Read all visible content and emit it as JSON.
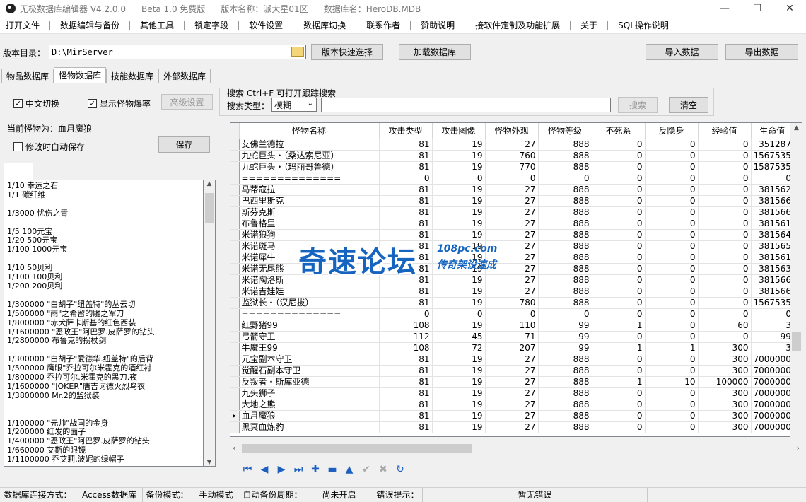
{
  "window": {
    "title_segments": [
      "无极数据库编辑器 V4.2.0.0",
      "Beta 1.0 免费版",
      "版本名称：派大星01区",
      "数据库名：HeroDB.MDB"
    ]
  },
  "menu": [
    "打开文件",
    "数据编辑与备份",
    "其他工具",
    "锁定字段",
    "软件设置",
    "数据库切换",
    "联系作者",
    "赞助说明",
    "接软件定制及功能扩展",
    "关于",
    "SQL操作说明"
  ],
  "toolbar": {
    "dir_label": "版本目录：",
    "dir_value": "D:\\MirServer",
    "quick_select": "版本快速选择",
    "load_db": "加载数据库",
    "import": "导入数据",
    "export": "导出数据"
  },
  "tabs": [
    "物品数据库",
    "怪物数据库",
    "技能数据库",
    "外部数据库"
  ],
  "options": {
    "chinese": "中文切换",
    "show_drop": "显示怪物爆率",
    "advanced": "高级设置",
    "current_monster": "当前怪物为：血月魔狼",
    "auto_save": "修改时自动保存",
    "save": "保存"
  },
  "search": {
    "title": "搜索   Ctrl+F 可打开跟踪搜索",
    "type_label": "搜索类型：",
    "type_value": "模糊",
    "search_btn": "搜索",
    "clear_btn": "清空"
  },
  "drop_list": "1/10 幸运之石\n1/1 碳纤维\n\n1/3000 忧伤之青\n\n1/5 100元宝\n1/20 500元宝\n1/100 1000元宝\n\n1/10 50贝利\n1/100 100贝利\n1/200 200贝利\n\n1/300000 \"白胡子\"纽盖特\"的丛云切\n1/500000 \"雨\"之希留的雕之军刀\n1/800000 \"赤犬萨卡斯基的红色西装\n1/1600000 \"恶政王\"阿巴罗.皮萨罗的钻头\n1/2800000 布鲁克的拐杖剑\n\n1/300000 \"白胡子\"爱德华.纽盖特\"的后背\n1/500000 鹰眼\"乔拉可尔米霍克的酒红衬\n1/800000 乔拉可尔.米霍克的黑刀.夜\n1/1600000 \"JOKER\"唐吉诃德火烈鸟衣\n1/3800000 Mr.2的监狱装\n\n\n1/100000 \"元帅\"战国的金身\n1/200000 红发的面子\n1/400000 \"恶政王\"阿巴罗.皮萨罗的钻头\n1/660000 艾斯的眼镜\n1/1100000 乔艾莉.波妮的绿帽子",
  "grid": {
    "columns": [
      "怪物名称",
      "攻击类型",
      "攻击图像",
      "怪物外观",
      "怪物等级",
      "不死系",
      "反隐身",
      "经验值",
      "生命值"
    ],
    "rows": [
      [
        "艾佛兰德拉",
        "81",
        "19",
        "27",
        "888",
        "0",
        "0",
        "0",
        "351287"
      ],
      [
        "九蛇巨头・（桑达索尼亚）",
        "81",
        "19",
        "760",
        "888",
        "0",
        "0",
        "0",
        "1567535"
      ],
      [
        "九蛇巨头・（玛丽哥鲁德）",
        "81",
        "19",
        "770",
        "888",
        "0",
        "0",
        "0",
        "1587535"
      ],
      [
        "==============",
        "0",
        "0",
        "0",
        "0",
        "0",
        "0",
        "0",
        "0"
      ],
      [
        "马蒂寇拉",
        "81",
        "19",
        "27",
        "888",
        "0",
        "0",
        "0",
        "381562"
      ],
      [
        "巴西里斯克",
        "81",
        "19",
        "27",
        "888",
        "0",
        "0",
        "0",
        "381566"
      ],
      [
        "斯芬克斯",
        "81",
        "19",
        "27",
        "888",
        "0",
        "0",
        "0",
        "381566"
      ],
      [
        "布鲁格里",
        "81",
        "19",
        "27",
        "888",
        "0",
        "0",
        "0",
        "381561"
      ],
      [
        "米诺狼狗",
        "81",
        "19",
        "27",
        "888",
        "0",
        "0",
        "0",
        "381564"
      ],
      [
        "米诺斑马",
        "81",
        "19",
        "27",
        "888",
        "0",
        "0",
        "0",
        "381565"
      ],
      [
        "米诺犀牛",
        "81",
        "19",
        "27",
        "888",
        "0",
        "0",
        "0",
        "381561"
      ],
      [
        "米诺无尾熊",
        "81",
        "19",
        "27",
        "888",
        "0",
        "0",
        "0",
        "381563"
      ],
      [
        "米诺陶洛斯",
        "81",
        "19",
        "27",
        "888",
        "0",
        "0",
        "0",
        "381566"
      ],
      [
        "米诺吉娃娃",
        "81",
        "19",
        "27",
        "888",
        "0",
        "0",
        "0",
        "381566"
      ],
      [
        "监狱长・（汉尼拔）",
        "81",
        "19",
        "780",
        "888",
        "0",
        "0",
        "0",
        "1567535"
      ],
      [
        "==============",
        "0",
        "0",
        "0",
        "0",
        "0",
        "0",
        "0",
        "0"
      ],
      [
        "红野猪99",
        "108",
        "19",
        "110",
        "99",
        "1",
        "0",
        "60",
        "3"
      ],
      [
        "弓箭守卫",
        "112",
        "45",
        "71",
        "99",
        "0",
        "0",
        "0",
        "99"
      ],
      [
        "牛魔王99",
        "108",
        "72",
        "207",
        "99",
        "1",
        "1",
        "300",
        "3"
      ],
      [
        "元宝副本守卫",
        "81",
        "19",
        "27",
        "888",
        "0",
        "0",
        "300",
        "7000000"
      ],
      [
        "觉醒石副本守卫",
        "81",
        "19",
        "27",
        "888",
        "0",
        "0",
        "300",
        "7000000"
      ],
      [
        "反叛者・斯库亚德",
        "81",
        "19",
        "27",
        "888",
        "1",
        "10",
        "100000",
        "7000000"
      ],
      [
        "九头狮子",
        "81",
        "19",
        "27",
        "888",
        "0",
        "0",
        "300",
        "7000000"
      ],
      [
        "大地之熊",
        "81",
        "19",
        "27",
        "888",
        "0",
        "0",
        "300",
        "7000000"
      ],
      [
        "血月魔狼",
        "81",
        "19",
        "27",
        "888",
        "0",
        "0",
        "300",
        "7000000"
      ],
      [
        "黑冥血炼豹",
        "81",
        "19",
        "27",
        "888",
        "0",
        "0",
        "300",
        "7000000"
      ]
    ],
    "current_row_index": 24
  },
  "watermark": {
    "main": "奇速论坛",
    "url": "108pc.com",
    "sub": "传奇架设速成"
  },
  "status": [
    "数据库连接方式：",
    "Access数据库",
    "备份模式：",
    "手动模式",
    "自动备份周期：",
    "尚未开启",
    "错误提示：",
    "暂无错误"
  ]
}
